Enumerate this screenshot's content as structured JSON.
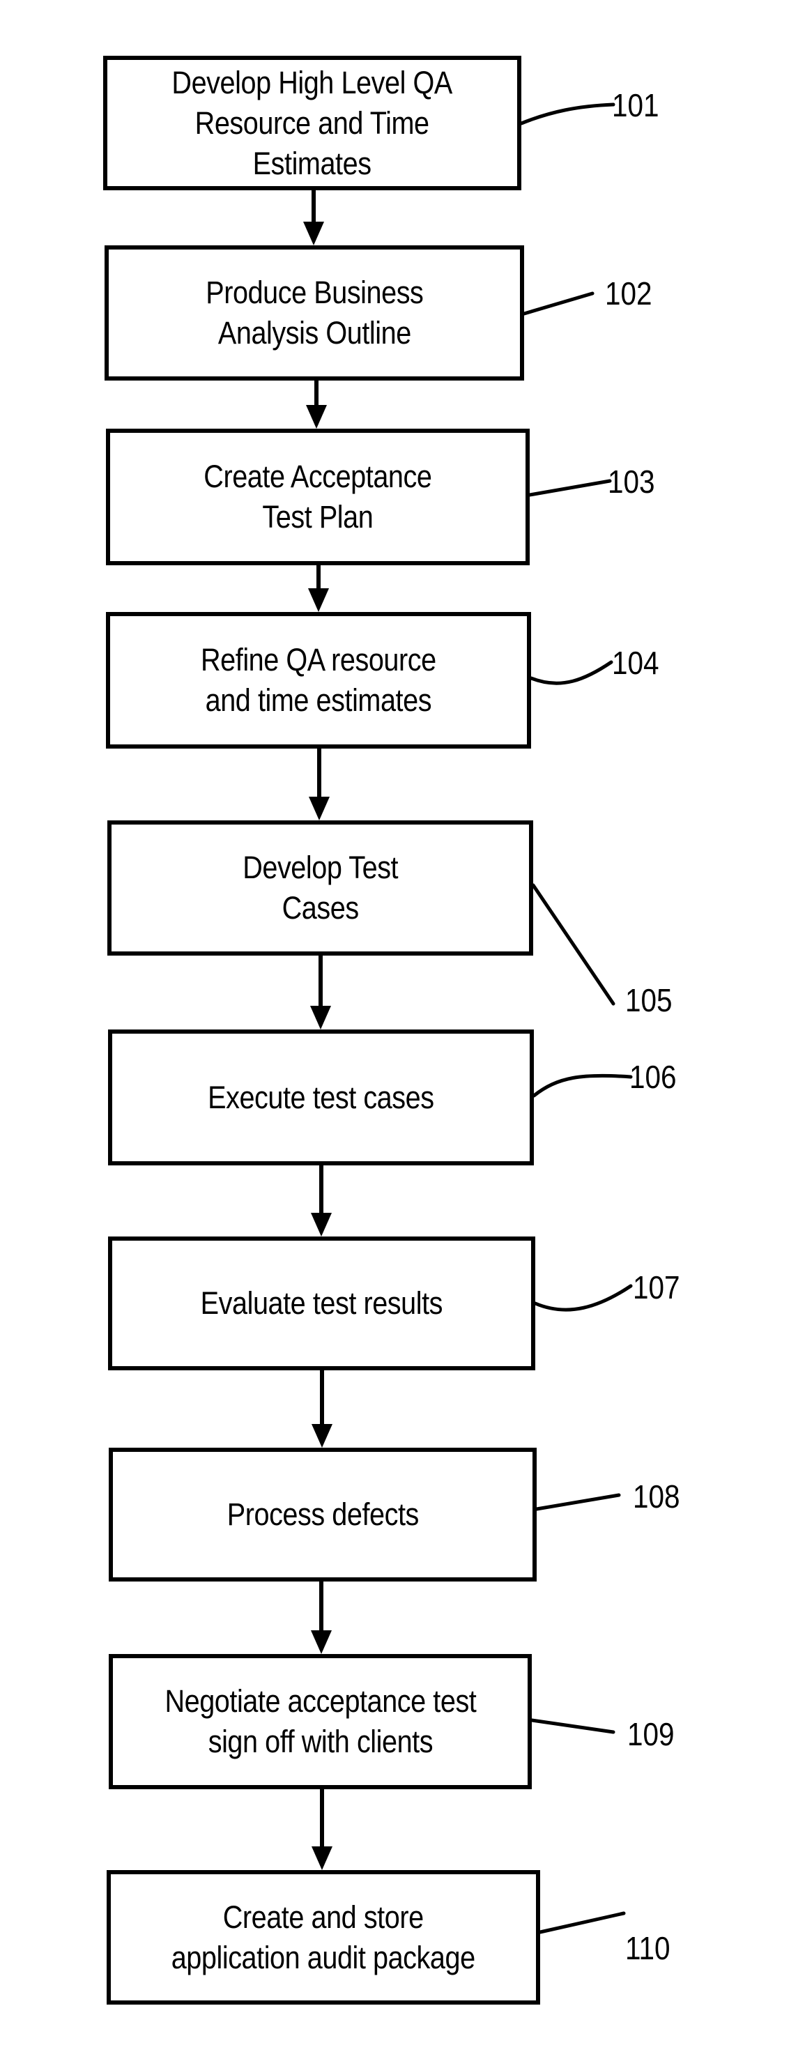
{
  "figure": {
    "type": "flowchart",
    "direction": "top-to-bottom",
    "colors": {
      "stroke": "#000000",
      "background": "#ffffff",
      "text": "#000000"
    },
    "steps": [
      {
        "ref": "101",
        "text": "Develop High Level QA\nResource and Time\nEstimates"
      },
      {
        "ref": "102",
        "text": "Produce Business\nAnalysis Outline"
      },
      {
        "ref": "103",
        "text": "Create Acceptance\nTest Plan"
      },
      {
        "ref": "104",
        "text": "Refine QA resource\nand time estimates"
      },
      {
        "ref": "105",
        "text": "Develop Test\nCases"
      },
      {
        "ref": "106",
        "text": "Execute test cases"
      },
      {
        "ref": "107",
        "text": "Evaluate test results"
      },
      {
        "ref": "108",
        "text": "Process defects"
      },
      {
        "ref": "109",
        "text": "Negotiate acceptance test\nsign off with clients"
      },
      {
        "ref": "110",
        "text": "Create and store\napplication audit package"
      }
    ],
    "edges": [
      [
        "101",
        "102"
      ],
      [
        "102",
        "103"
      ],
      [
        "103",
        "104"
      ],
      [
        "104",
        "105"
      ],
      [
        "105",
        "106"
      ],
      [
        "106",
        "107"
      ],
      [
        "107",
        "108"
      ],
      [
        "108",
        "109"
      ],
      [
        "109",
        "110"
      ]
    ]
  }
}
